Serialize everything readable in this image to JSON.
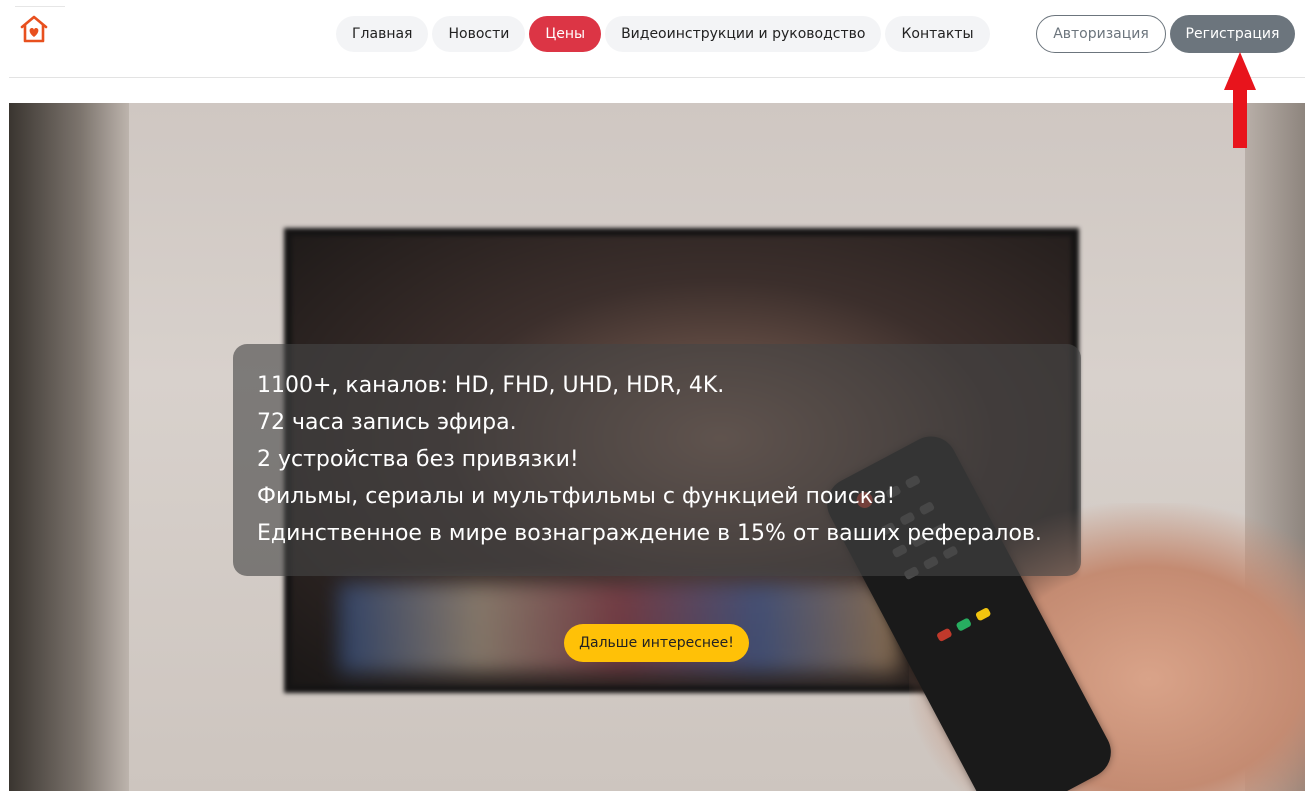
{
  "logo": {
    "icon": "house-heart-icon",
    "color": "#e8501e"
  },
  "nav": {
    "items": [
      {
        "label": "Главная",
        "active": false
      },
      {
        "label": "Новости",
        "active": false
      },
      {
        "label": "Цены",
        "active": true
      },
      {
        "label": "Видеоинструкции и руководство",
        "active": false
      },
      {
        "label": "Контакты",
        "active": false
      }
    ]
  },
  "auth": {
    "login_label": "Авторизация",
    "register_label": "Регистрация"
  },
  "hero": {
    "lines": [
      "1100+, каналов: HD, FHD, UHD, HDR, 4K.",
      "72 часа запись эфира.",
      "2 устройства без привязки!",
      "Фильмы, сериалы и мультфильмы с функцией поиска!",
      "Единственное в мире вознаграждение в 15% от ваших рефералов."
    ],
    "cta_label": "Дальше интереснее!"
  },
  "annotation": {
    "icon": "arrow-up-icon",
    "color": "#e8141c"
  },
  "colors": {
    "active_nav": "#dc3545",
    "secondary": "#6c757d",
    "cta": "#ffc107"
  }
}
